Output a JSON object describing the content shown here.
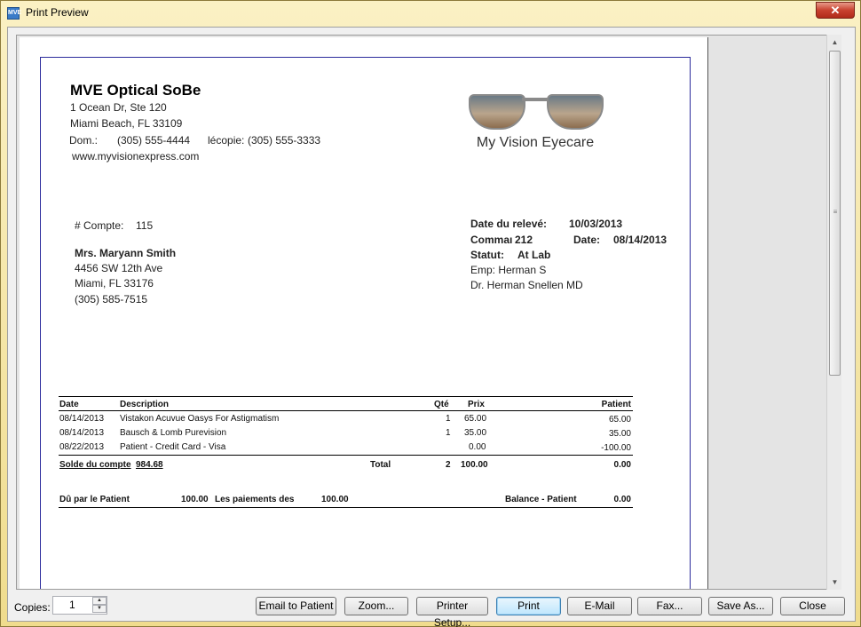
{
  "window": {
    "title": "Print Preview",
    "close_symbol": "✕",
    "app_icon_text": "MVE"
  },
  "header": {
    "company_name": "MVE Optical SoBe",
    "address1": "1 Ocean Dr, Ste 120",
    "address2": "Miami Beach, FL 33109",
    "phone_label": "Dom.:",
    "phone": "(305) 555-4444",
    "fax_label": "lécopie:",
    "fax": "(305) 555-3333",
    "website": "www.myvisionexpress.com",
    "logo_text": "My Vision Eyecare"
  },
  "account": {
    "label": "# Compte:",
    "number": "115",
    "patient_name": "Mrs. Maryann Smith",
    "address1": "4456 SW 12th Ave",
    "address2": "Miami, FL 33176",
    "phone": "(305) 585-7515"
  },
  "statement": {
    "date_label": "Date du relevé:",
    "date": "10/03/2013",
    "order_label": "Commaı",
    "order_number": "212",
    "order_date_label": "Date:",
    "order_date": "08/14/2013",
    "status_label": "Statut:",
    "status": "At Lab",
    "emp": "Emp: Herman S",
    "doctor": "Dr. Herman Snellen MD"
  },
  "table": {
    "headers": {
      "date": "Date",
      "description": "Description",
      "qty": "Qté",
      "price": "Prix",
      "patient": "Patient"
    },
    "rows": [
      {
        "date": "08/14/2013",
        "description": "Vistakon Acuvue Oasys For Astigmatism",
        "qty": "1",
        "price": "65.00",
        "patient": "65.00"
      },
      {
        "date": "08/14/2013",
        "description": "Bausch & Lomb Purevision",
        "qty": "1",
        "price": "35.00",
        "patient": "35.00"
      },
      {
        "date": "08/22/2013",
        "description": "Patient - Credit Card - Visa",
        "qty": "",
        "price": "0.00",
        "patient": "-100.00"
      }
    ],
    "balance_label": "Solde du compte",
    "balance_value": "984.68",
    "total_label": "Total",
    "total_qty": "2",
    "total_price": "100.00",
    "total_patient": "0.00"
  },
  "summary": {
    "due_label": "Dû par le Patient",
    "due_value": "100.00",
    "payments_label": "Les paiements des",
    "payments_value": "100.00",
    "balance_label": "Balance - Patient",
    "balance_value": "0.00"
  },
  "footer": {
    "copies_label": "Copies:",
    "copies_value": "1",
    "buttons": {
      "email_patient": "Email to Patient",
      "zoom": "Zoom...",
      "printer_setup": "Printer Setup...",
      "print": "Print",
      "email": "E-Mail",
      "fax": "Fax...",
      "save_as": "Save As...",
      "close": "Close"
    }
  }
}
